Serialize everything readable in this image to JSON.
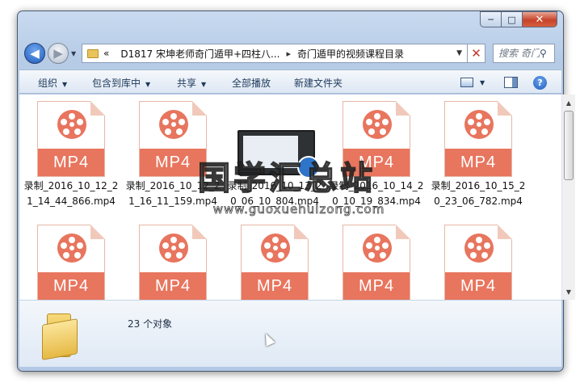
{
  "window": {
    "controls": {
      "minimize": "─",
      "maximize": "□",
      "close": "✕"
    }
  },
  "nav": {
    "back": "◀",
    "forward": "▶",
    "recent": "▼",
    "address_overflow": "«",
    "address_segments": [
      "D1817 宋坤老师奇门遁甲+四柱八...",
      "奇门遁甲的视频课程目录"
    ],
    "address_sep": "▸",
    "address_dropdown": "▼",
    "refresh": "✕",
    "search_placeholder": "搜索 奇门...",
    "search_icon": "⚲"
  },
  "toolbar": {
    "organize": "组织",
    "include_in_library": "包含到库中",
    "share": "共享",
    "play_all": "全部播放",
    "new_folder": "新建文件夹",
    "dropdown": "▼",
    "help": "?"
  },
  "files": [
    {
      "type_label": "MP4",
      "name": "录制_2016_10_12_21_14_44_866.mp4"
    },
    {
      "type_label": "MP4",
      "name": "录制_2016_10_12_21_16_11_159.mp4"
    },
    {
      "type_label": "MP4",
      "name": "录制_2016_10_13_20_06_10_804.mp4"
    },
    {
      "type_label": "MP4",
      "name": "录制_2016_10_14_20_10_19_834.mp4"
    },
    {
      "type_label": "MP4",
      "name": "录制_2016_10_15_20_23_06_782.mp4"
    },
    {
      "type_label": "MP4",
      "name": ""
    },
    {
      "type_label": "MP4",
      "name": ""
    },
    {
      "type_label": "MP4",
      "name": ""
    },
    {
      "type_label": "MP4",
      "name": ""
    },
    {
      "type_label": "MP4",
      "name": ""
    }
  ],
  "scrollbar": {
    "up": "▲",
    "down": "▼",
    "position": 0.0
  },
  "details": {
    "count": "23 个对象"
  },
  "watermark": {
    "title": "国学汇总站",
    "url": "www.guoxuehuizong.com"
  },
  "colors": {
    "mp4_accent": "#e8755e",
    "folder": "#e6b945",
    "chrome": "#b6cbe6"
  }
}
